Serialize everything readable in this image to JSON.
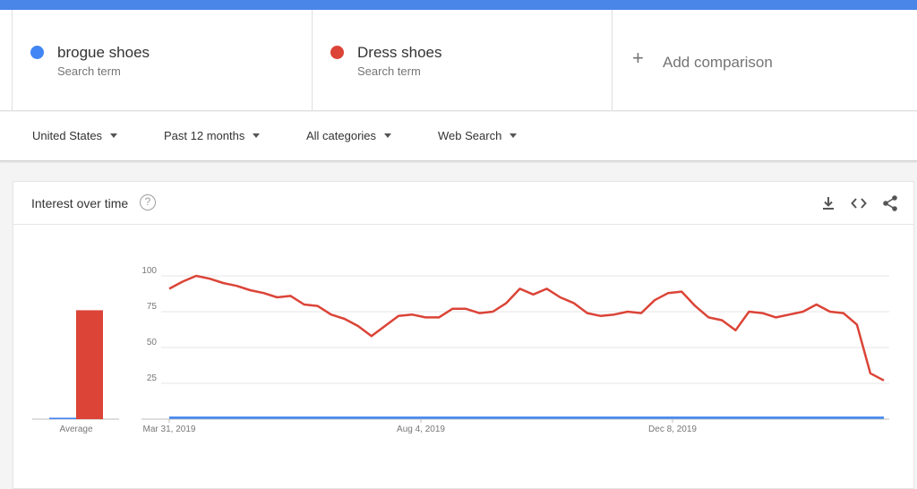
{
  "terms": [
    {
      "name": "brogue shoes",
      "sub": "Search term",
      "color": "#4285f4"
    },
    {
      "name": "Dress shoes",
      "sub": "Search term",
      "color": "#db4437"
    }
  ],
  "add_comparison": {
    "label": "Add comparison"
  },
  "filters": [
    {
      "label": "United States"
    },
    {
      "label": "Past 12 months"
    },
    {
      "label": "All categories"
    },
    {
      "label": "Web Search"
    }
  ],
  "panel": {
    "title": "Interest over time",
    "help": "?",
    "icons": [
      "download-icon",
      "embed-code-icon",
      "share-icon"
    ]
  },
  "chart_data": {
    "type": "line",
    "y_ticks": [
      25,
      50,
      75,
      100
    ],
    "ylim": [
      0,
      100
    ],
    "x_tick_labels": [
      "Mar 31, 2019",
      "Aug 4, 2019",
      "Dec 8, 2019"
    ],
    "average_label": "Average",
    "averages": [
      {
        "series": "brogue shoes",
        "value": 1,
        "color": "#4285f4"
      },
      {
        "series": "Dress shoes",
        "value": 76,
        "color": "#db4437"
      }
    ],
    "series": [
      {
        "name": "Dress shoes",
        "color": "#db4437",
        "values": [
          91,
          96,
          100,
          98,
          95,
          93,
          90,
          88,
          85,
          86,
          80,
          79,
          73,
          70,
          65,
          58,
          65,
          72,
          73,
          71,
          71,
          77,
          77,
          74,
          75,
          81,
          91,
          87,
          91,
          85,
          81,
          74,
          72,
          73,
          75,
          74,
          83,
          88,
          89,
          79,
          71,
          69,
          62,
          75,
          74,
          71,
          73,
          75,
          80,
          75,
          74,
          66,
          32,
          27
        ]
      },
      {
        "name": "brogue shoes",
        "color": "#4285f4",
        "values": [
          1,
          1,
          1,
          1,
          1,
          1,
          1,
          1,
          1,
          1,
          1,
          1,
          1,
          1,
          1,
          1,
          1,
          1,
          1,
          1,
          1,
          1,
          1,
          1,
          1,
          1,
          1,
          1,
          1,
          1,
          1,
          1,
          1,
          1,
          1,
          1,
          1,
          1,
          1,
          1,
          1,
          1,
          1,
          1,
          1,
          1,
          1,
          1,
          1,
          1,
          1,
          1,
          1,
          1
        ]
      }
    ]
  }
}
